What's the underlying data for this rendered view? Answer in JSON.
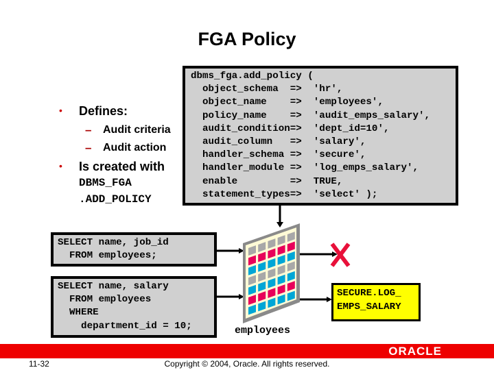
{
  "slide": {
    "title": "FGA Policy",
    "bullets": [
      {
        "text": "Defines:",
        "sub": [
          "Audit criteria",
          "Audit action"
        ]
      },
      {
        "text": "Is created with",
        "code_lines": [
          "DBMS_FGA",
          ".ADD_POLICY"
        ]
      }
    ],
    "bullet_glyph": "•",
    "dash_glyph": "–",
    "policy_code": [
      "dbms_fga.add_policy (",
      "  object_schema  =>  'hr',",
      "  object_name    =>  'employees',",
      "  policy_name    =>  'audit_emps_salary',",
      "  audit_condition=>  'dept_id=10',",
      "  audit_column   =>  'salary',",
      "  handler_schema =>  'secure',",
      "  handler_module =>  'log_emps_salary',",
      "  enable         =>  TRUE,",
      "  statement_types=>  'select' );"
    ],
    "queries": [
      {
        "lines": [
          "SELECT name, job_id",
          "  FROM employees;"
        ],
        "result": "blocked"
      },
      {
        "lines": [
          "SELECT name, salary",
          "  FROM employees",
          "  WHERE",
          "    department_id = 10;"
        ],
        "result": "handler"
      }
    ],
    "table_label": "employees",
    "table_rows": [
      "gray",
      "pink",
      "blue",
      "gray",
      "blue",
      "pink",
      "blue"
    ],
    "handler_label": [
      "SECURE.LOG_",
      "EMPS_SALARY"
    ],
    "blocked_icon": "red-x-icon",
    "colors": {
      "red": "#ee0000",
      "pink": "#e8005a",
      "blue": "#00a6d6",
      "gray": "#a8a8a8",
      "yellow": "#ffff00",
      "cream": "#fffbd6"
    }
  },
  "footer": {
    "slide_number": "11-32",
    "copyright": "Copyright © 2004, Oracle.  All rights reserved.",
    "brand": "ORACLE"
  }
}
